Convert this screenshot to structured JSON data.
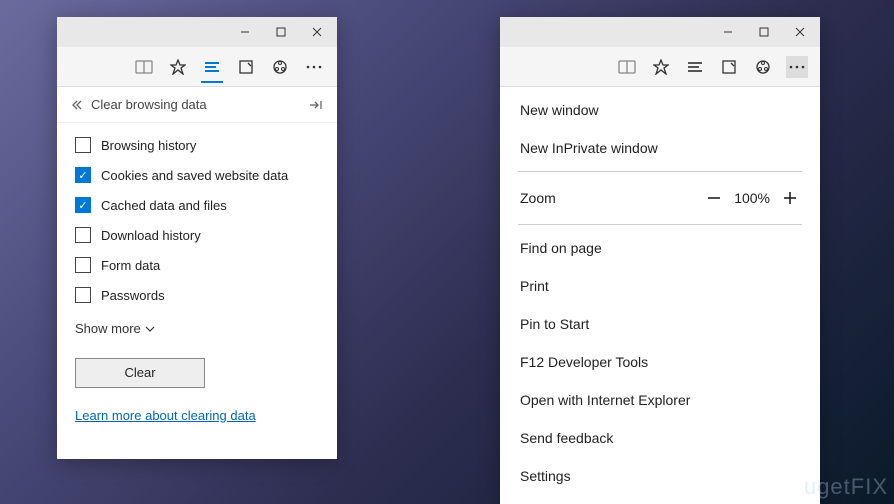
{
  "left_window": {
    "panel_title": "Clear browsing data",
    "items": [
      {
        "label": "Browsing history",
        "checked": false
      },
      {
        "label": "Cookies and saved website data",
        "checked": true
      },
      {
        "label": "Cached data and files",
        "checked": true
      },
      {
        "label": "Download history",
        "checked": false
      },
      {
        "label": "Form data",
        "checked": false
      },
      {
        "label": "Passwords",
        "checked": false
      }
    ],
    "show_more": "Show more",
    "clear_button": "Clear",
    "learn_more": "Learn more about clearing data"
  },
  "right_window": {
    "menu": {
      "new_window": "New window",
      "new_inprivate": "New InPrivate window",
      "zoom_label": "Zoom",
      "zoom_value": "100%",
      "find": "Find on page",
      "print": "Print",
      "pin": "Pin to Start",
      "devtools": "F12 Developer Tools",
      "open_ie": "Open with Internet Explorer",
      "feedback": "Send feedback",
      "settings": "Settings"
    }
  },
  "watermark": "ugetFIX"
}
